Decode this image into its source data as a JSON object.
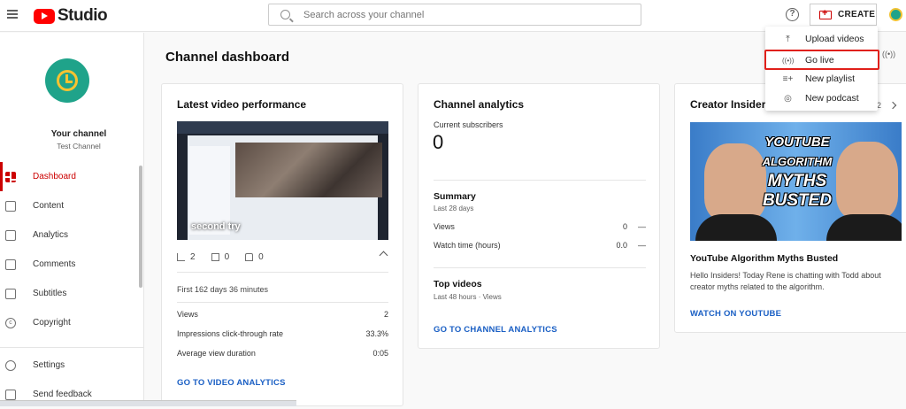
{
  "header": {
    "logo_text": "Studio",
    "search_placeholder": "Search across your channel",
    "help_glyph": "?",
    "create_label": "CREATE"
  },
  "create_menu": {
    "items": [
      {
        "label": "Upload videos",
        "icon": "upload-icon"
      },
      {
        "label": "Go live",
        "icon": "live-icon"
      },
      {
        "label": "New playlist",
        "icon": "playlist-add-icon"
      },
      {
        "label": "New podcast",
        "icon": "podcast-icon"
      }
    ],
    "highlighted": "Go live"
  },
  "sidebar": {
    "channel_title": "Your channel",
    "channel_name": "Test Channel",
    "items": [
      {
        "label": "Dashboard",
        "icon": "dashboard-icon",
        "active": true
      },
      {
        "label": "Content",
        "icon": "content-icon"
      },
      {
        "label": "Analytics",
        "icon": "analytics-icon"
      },
      {
        "label": "Comments",
        "icon": "comments-icon"
      },
      {
        "label": "Subtitles",
        "icon": "subtitles-icon"
      },
      {
        "label": "Copyright",
        "icon": "copyright-icon"
      }
    ],
    "bottom_items": [
      {
        "label": "Settings",
        "icon": "gear-icon"
      },
      {
        "label": "Send feedback",
        "icon": "feedback-icon"
      }
    ]
  },
  "main": {
    "page_title": "Channel dashboard",
    "latest_video": {
      "title": "Latest video performance",
      "thumb_label": "second try",
      "views_count": "2",
      "comments_count": "0",
      "likes_count": "0",
      "period": "First 162 days 36 minutes",
      "metrics": [
        {
          "label": "Views",
          "value": "2"
        },
        {
          "label": "Impressions click-through rate",
          "value": "33.3%"
        },
        {
          "label": "Average view duration",
          "value": "0:05"
        }
      ],
      "link": "GO TO VIDEO ANALYTICS"
    },
    "channel_analytics": {
      "title": "Channel analytics",
      "subscribers_label": "Current subscribers",
      "subscribers_value": "0",
      "summary_title": "Summary",
      "summary_period": "Last 28 days",
      "rows": [
        {
          "label": "Views",
          "value": "0",
          "trend": "—"
        },
        {
          "label": "Watch time (hours)",
          "value": "0.0",
          "trend": "—"
        }
      ],
      "top_videos_title": "Top videos",
      "top_videos_sub": "Last 48 hours · Views",
      "link": "GO TO CHANNEL ANALYTICS"
    },
    "creator_insider": {
      "title": "Creator Insider",
      "page_indicator": "2",
      "thumb_text_1": "YOUTUBE",
      "thumb_text_2": "ALGORITHM",
      "thumb_text_3": "MYTHS",
      "thumb_text_4": "BUSTED",
      "video_title": "YouTube Algorithm Myths Busted",
      "description": "Hello Insiders! Today Rene is chatting with Todd about creator myths related to the algorithm.",
      "link": "WATCH ON YOUTUBE"
    }
  },
  "colors": {
    "accent_red": "#cc0000",
    "link_blue": "#1a5fc4",
    "highlight_box": "#e0201a",
    "avatar_teal": "#1fa38a",
    "avatar_yellow": "#f7c331"
  }
}
